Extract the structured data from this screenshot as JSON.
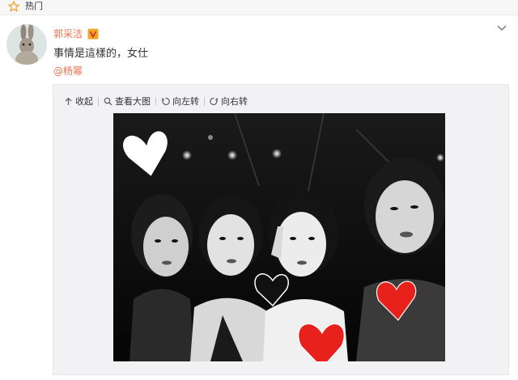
{
  "section": {
    "label": "热门",
    "icon": "star-icon"
  },
  "post": {
    "author": "郭采洁",
    "verified_icon": "verified-v-icon",
    "text": "事情是這樣的，女仕",
    "mention": "@杨幂",
    "more_icon": "chevron-down-icon"
  },
  "toolbar": {
    "collapse": "收起",
    "view_large": "查看大图",
    "rotate_left": "向左转",
    "rotate_right": "向右转"
  },
  "photo": {
    "description_icon": "group-selfie-photo",
    "colors": {
      "heart_red": "#e8211c",
      "heart_white": "#ffffff",
      "heart_black": "#111111"
    }
  },
  "colors": {
    "accent": "#eb7350",
    "star": "#f0a020",
    "panel_bg": "#f2f2f5"
  }
}
